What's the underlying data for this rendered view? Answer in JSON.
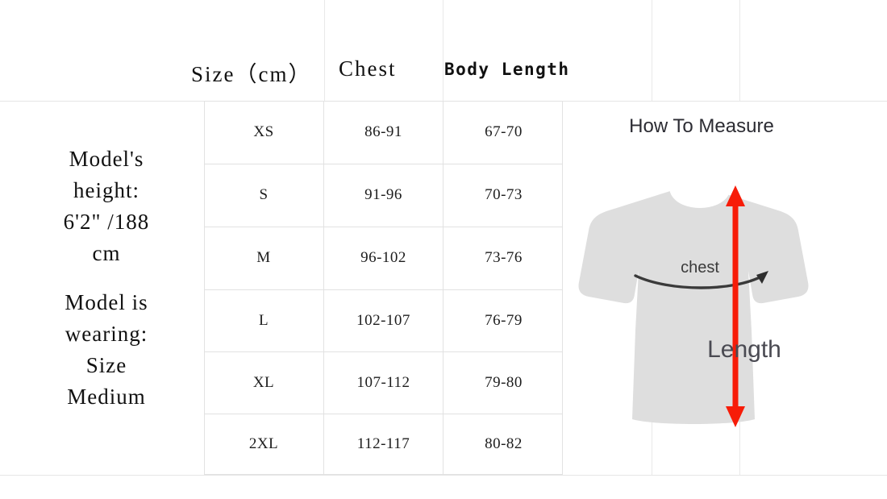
{
  "table": {
    "headers": {
      "size": "Size（cm）",
      "chest": "Chest",
      "body_length": "Body Length"
    },
    "rows": [
      {
        "size": "XS",
        "chest": "86-91",
        "length": "67-70"
      },
      {
        "size": "S",
        "chest": "91-96",
        "length": "70-73"
      },
      {
        "size": "M",
        "chest": "96-102",
        "length": "73-76"
      },
      {
        "size": "L",
        "chest": "102-107",
        "length": "76-79"
      },
      {
        "size": "XL",
        "chest": "107-112",
        "length": "79-80"
      },
      {
        "size": "2XL",
        "chest": "112-117",
        "length": "80-82"
      }
    ]
  },
  "model_note": {
    "line1": "Model's",
    "line2": "height:",
    "line3": "6'2\" /188",
    "line4": "cm",
    "line5": "Model is",
    "line6": "wearing:",
    "line7": "Size",
    "line8": "Medium"
  },
  "how_to_measure": {
    "title": "How To Measure",
    "chest_label": "chest",
    "length_label": "Length"
  },
  "colors": {
    "arrow_red": "#f71c08",
    "shirt_gray": "#dedede",
    "chest_arrow": "#3a3a3a",
    "grid": "#e6e6e6",
    "text": "#111111"
  }
}
